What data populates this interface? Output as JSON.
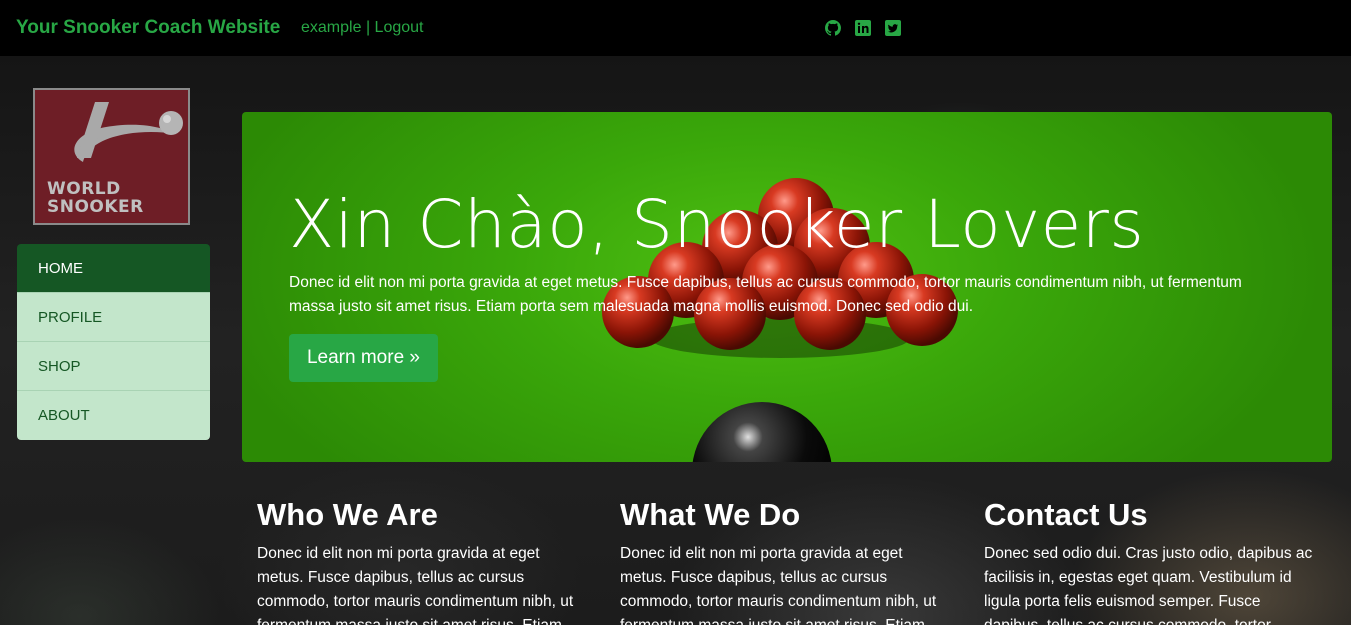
{
  "navbar": {
    "brand": "Your Snooker Coach Website",
    "username": "example",
    "separator": "|",
    "logout": "Logout",
    "socials": [
      {
        "icon": "github-icon"
      },
      {
        "icon": "linkedin-icon"
      },
      {
        "icon": "twitter-icon"
      }
    ],
    "accent_color": "#28a745"
  },
  "logo": {
    "line1": "WORLD",
    "line2": "SNOOKER"
  },
  "sidebar": {
    "items": [
      {
        "label": "HOME",
        "active": true
      },
      {
        "label": "PROFILE",
        "active": false
      },
      {
        "label": "SHOP",
        "active": false
      },
      {
        "label": "ABOUT",
        "active": false
      }
    ]
  },
  "hero": {
    "title": "Xin Chào, Snooker Lovers",
    "text": "Donec id elit non mi porta gravida at eget metus. Fusce dapibus, tellus ac cursus commodo, tortor mauris condimentum nibh, ut fermentum massa justo sit amet risus. Etiam porta sem malesuada magna mollis euismod. Donec sed odio dui.",
    "button": "Learn more »"
  },
  "columns": [
    {
      "heading": "Who We Are",
      "text": "Donec id elit non mi porta gravida at eget metus. Fusce dapibus, tellus ac cursus commodo, tortor mauris condimentum nibh, ut fermentum massa justo sit amet risus. Etiam"
    },
    {
      "heading": "What We Do",
      "text": "Donec id elit non mi porta gravida at eget metus. Fusce dapibus, tellus ac cursus commodo, tortor mauris condimentum nibh, ut fermentum massa justo sit amet risus. Etiam"
    },
    {
      "heading": "Contact Us",
      "text": "Donec sed odio dui. Cras justo odio, dapibus ac facilisis in, egestas eget quam. Vestibulum id ligula porta felis euismod semper. Fusce dapibus, tellus ac cursus commodo, tortor"
    }
  ]
}
